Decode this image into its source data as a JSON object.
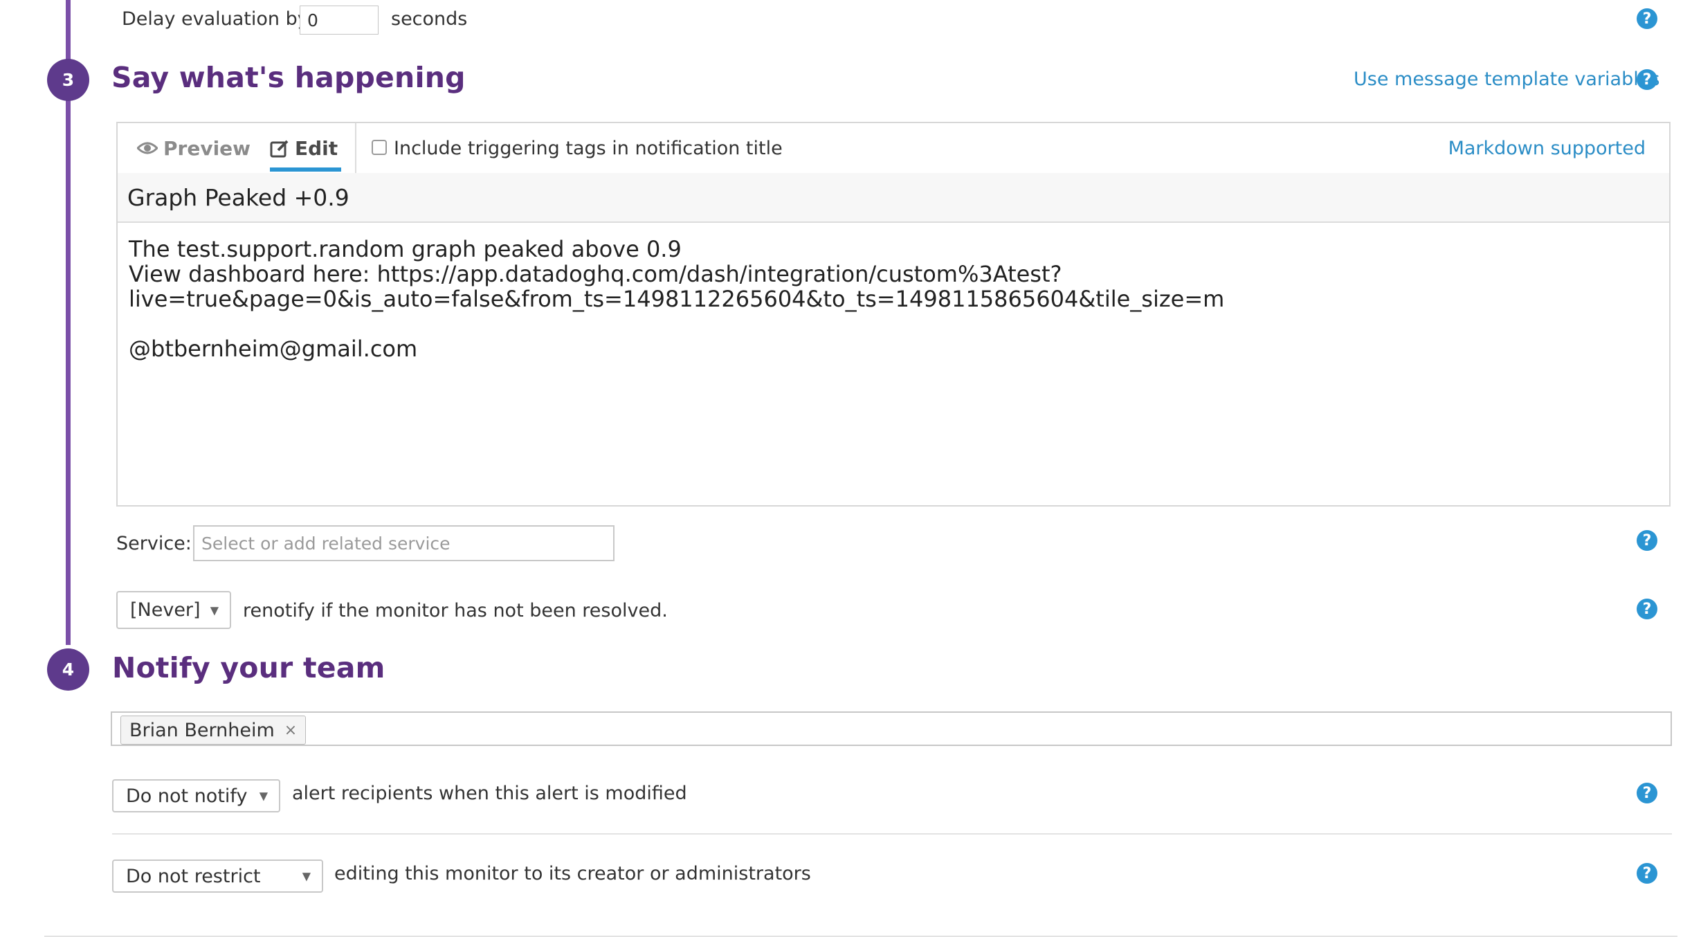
{
  "delay": {
    "label_before": "Delay evaluation by",
    "value": "0",
    "label_after": "seconds"
  },
  "step3": {
    "number": "3",
    "title": "Say what's happening",
    "template_link": "Use message template variables"
  },
  "editor": {
    "tab_preview": "Preview",
    "tab_edit": "Edit",
    "checkbox_label": "Include triggering tags in notification title",
    "markdown_link": "Markdown supported",
    "title_value": "Graph Peaked +0.9",
    "body_value": "The test.support.random graph peaked above 0.9\nView dashboard here: https://app.datadoghq.com/dash/integration/custom%3Atest?\nlive=true&page=0&is_auto=false&from_ts=1498112265604&to_ts=1498115865604&tile_size=m\n\n@btbernheim@gmail.com"
  },
  "service": {
    "label": "Service:",
    "placeholder": "Select or add related service"
  },
  "renotify": {
    "selected": "[Never]",
    "text": "renotify if the monitor has not been resolved."
  },
  "step4": {
    "number": "4",
    "title": "Notify your team",
    "recipients": [
      "Brian Bernheim"
    ]
  },
  "modified": {
    "selected": "Do not notify",
    "text": "alert recipients when this alert is modified"
  },
  "restrict": {
    "selected": "Do not restrict",
    "text": "editing this monitor to its creator or administrators"
  },
  "icons": {
    "help": "?",
    "preview": "eye-icon",
    "edit": "edit-icon",
    "remove": "×",
    "caret": "▼"
  },
  "colors": {
    "accent_purple": "#5a2e7e",
    "timeline": "#7b4fa8",
    "link_blue": "#2b8dc6",
    "help_blue": "#2b95d3"
  }
}
